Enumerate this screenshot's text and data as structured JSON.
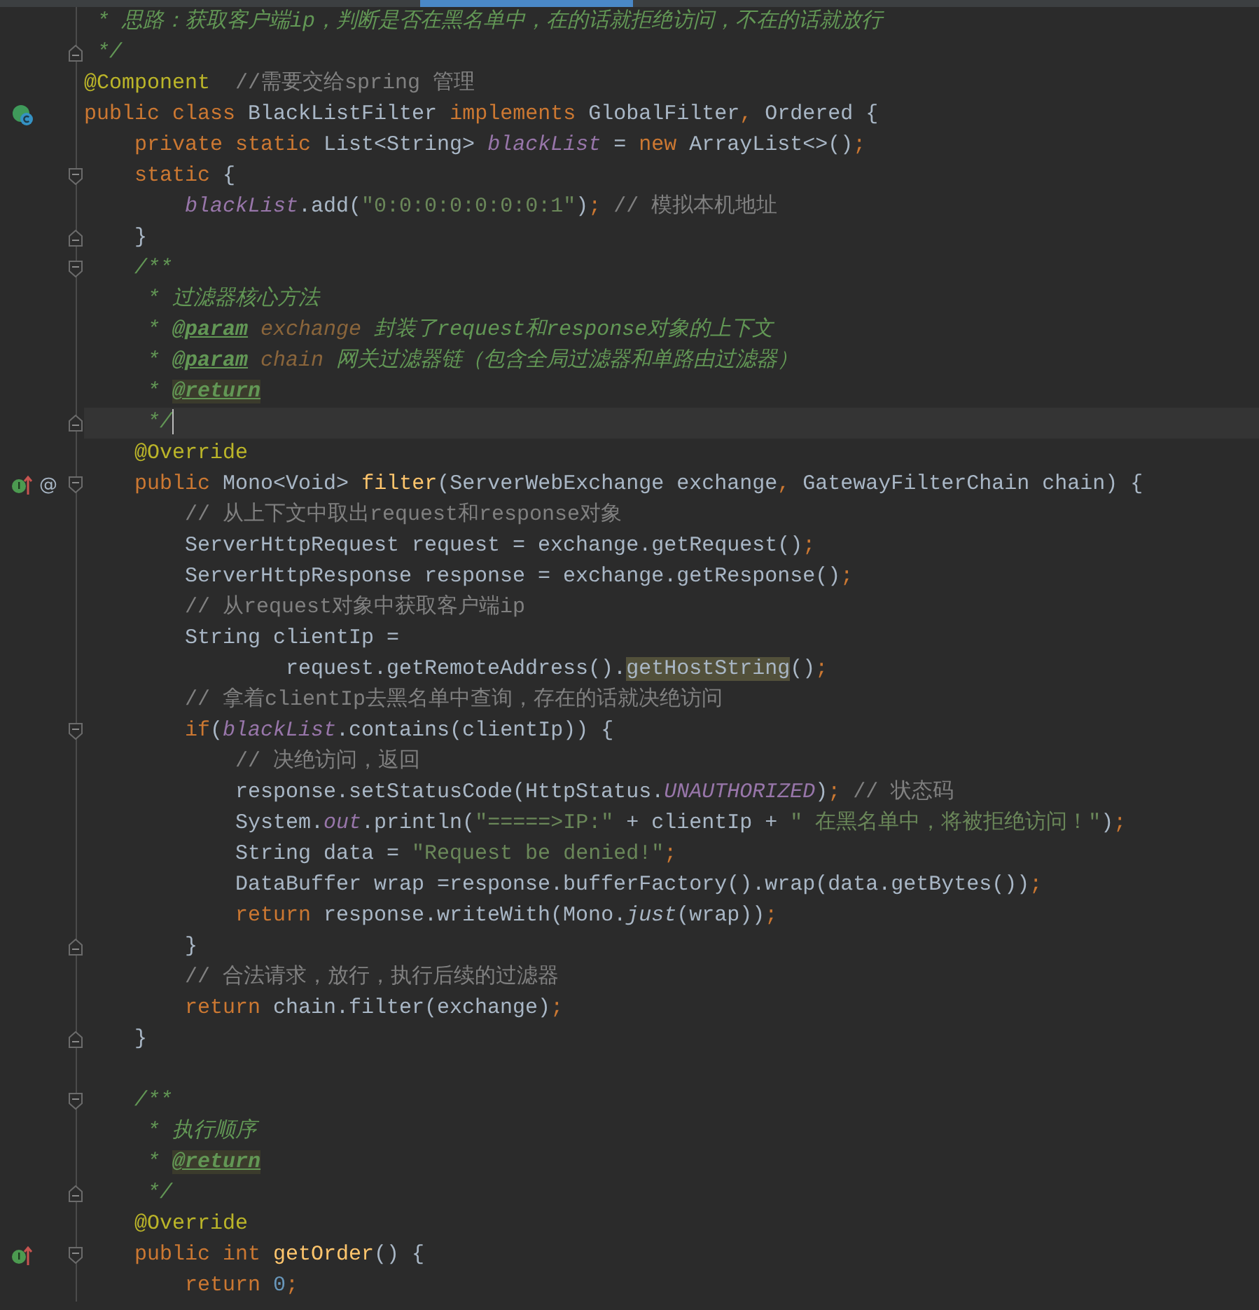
{
  "lines": [
    {
      "current": false,
      "tokens": [
        {
          "kind": "doc",
          "text": " * 思路：获取客户端ip，判断是否在黑名单中，在的话就拒绝访问，不在的话就放行"
        }
      ]
    },
    {
      "current": false,
      "fold": {
        "kind": "end"
      },
      "tokens": [
        {
          "kind": "doc",
          "text": " */"
        }
      ]
    },
    {
      "current": false,
      "tokens": [
        {
          "kind": "ann",
          "text": "@Component"
        },
        {
          "kind": "cmt",
          "text": "  //需要交给spring 管理"
        }
      ]
    },
    {
      "current": false,
      "gutter_icons": [
        {
          "kind": "class"
        }
      ],
      "tokens": [
        {
          "kind": "kw",
          "text": "public class "
        },
        {
          "kind": "plain",
          "text": "BlackListFilter "
        },
        {
          "kind": "kw",
          "text": "implements "
        },
        {
          "kind": "plain",
          "text": "GlobalFilter"
        },
        {
          "kind": "kw",
          "text": ", "
        },
        {
          "kind": "plain",
          "text": "Ordered {"
        }
      ]
    },
    {
      "current": false,
      "tokens": [
        {
          "kind": "kw",
          "text": "    private static "
        },
        {
          "kind": "plain",
          "text": "List<String> "
        },
        {
          "kind": "field",
          "text": "blackList"
        },
        {
          "kind": "plain",
          "text": " = "
        },
        {
          "kind": "kw",
          "text": "new "
        },
        {
          "kind": "plain",
          "text": "ArrayList<>()"
        },
        {
          "kind": "kw",
          "text": ";"
        }
      ]
    },
    {
      "current": false,
      "fold": {
        "kind": "start"
      },
      "tokens": [
        {
          "kind": "kw",
          "text": "    static "
        },
        {
          "kind": "plain",
          "text": "{"
        }
      ]
    },
    {
      "current": false,
      "tokens": [
        {
          "kind": "field",
          "text": "        blackList"
        },
        {
          "kind": "plain",
          "text": ".add("
        },
        {
          "kind": "str",
          "text": "\"0:0:0:0:0:0:0:1\""
        },
        {
          "kind": "plain",
          "text": ")"
        },
        {
          "kind": "kw",
          "text": "; "
        },
        {
          "kind": "cmt",
          "text": "// 模拟本机地址"
        }
      ]
    },
    {
      "current": false,
      "fold": {
        "kind": "end"
      },
      "tokens": [
        {
          "kind": "plain",
          "text": "    }"
        }
      ]
    },
    {
      "current": false,
      "fold": {
        "kind": "start"
      },
      "tokens": [
        {
          "kind": "doc",
          "text": "    /**"
        }
      ]
    },
    {
      "current": false,
      "tokens": [
        {
          "kind": "doc",
          "text": "     * 过滤器核心方法"
        }
      ]
    },
    {
      "current": false,
      "tokens": [
        {
          "kind": "doc",
          "text": "     * "
        },
        {
          "kind": "doctag",
          "text": "@param"
        },
        {
          "kind": "docparam",
          "text": " exchange"
        },
        {
          "kind": "doc",
          "text": " 封装了request和response对象的上下文"
        }
      ]
    },
    {
      "current": false,
      "tokens": [
        {
          "kind": "doc",
          "text": "     * "
        },
        {
          "kind": "doctag",
          "text": "@param"
        },
        {
          "kind": "docparam",
          "text": " chain"
        },
        {
          "kind": "doc",
          "text": " 网关过滤器链（包含全局过滤器和单路由过滤器）"
        }
      ]
    },
    {
      "current": false,
      "tokens": [
        {
          "kind": "doc",
          "text": "     * "
        },
        {
          "kind": "doctaghl",
          "text": "@return"
        }
      ]
    },
    {
      "current": true,
      "fold": {
        "kind": "end"
      },
      "tokens": [
        {
          "kind": "doc",
          "text": "     */"
        }
      ]
    },
    {
      "current": false,
      "tokens": [
        {
          "kind": "ann",
          "text": "    @Override"
        }
      ]
    },
    {
      "current": false,
      "fold": {
        "kind": "start"
      },
      "gutter_icons": [
        {
          "kind": "override"
        }
      ],
      "gutter_text": "@",
      "tokens": [
        {
          "kind": "kw",
          "text": "    public "
        },
        {
          "kind": "plain",
          "text": "Mono<Void> "
        },
        {
          "kind": "decl",
          "text": "filter"
        },
        {
          "kind": "plain",
          "text": "(ServerWebExchange exchange"
        },
        {
          "kind": "kw",
          "text": ", "
        },
        {
          "kind": "plain",
          "text": "GatewayFilterChain chain) {"
        }
      ]
    },
    {
      "current": false,
      "tokens": [
        {
          "kind": "cmt",
          "text": "        // 从上下文中取出request和response对象"
        }
      ]
    },
    {
      "current": false,
      "tokens": [
        {
          "kind": "plain",
          "text": "        ServerHttpRequest request = exchange.getRequest()"
        },
        {
          "kind": "kw",
          "text": ";"
        }
      ]
    },
    {
      "current": false,
      "tokens": [
        {
          "kind": "plain",
          "text": "        ServerHttpResponse response = exchange.getResponse()"
        },
        {
          "kind": "kw",
          "text": ";"
        }
      ]
    },
    {
      "current": false,
      "tokens": [
        {
          "kind": "cmt",
          "text": "        // 从request对象中获取客户端ip"
        }
      ]
    },
    {
      "current": false,
      "tokens": [
        {
          "kind": "plain",
          "text": "        String clientIp ="
        }
      ]
    },
    {
      "current": false,
      "tokens": [
        {
          "kind": "plain",
          "text": "                request.getRemoteAddress()."
        },
        {
          "kind": "usage",
          "text": "getHostString"
        },
        {
          "kind": "plain",
          "text": "()"
        },
        {
          "kind": "kw",
          "text": ";"
        }
      ]
    },
    {
      "current": false,
      "tokens": [
        {
          "kind": "cmt",
          "text": "        // 拿着clientIp去黑名单中查询，存在的话就决绝访问"
        }
      ]
    },
    {
      "current": false,
      "fold": {
        "kind": "start"
      },
      "tokens": [
        {
          "kind": "kw",
          "text": "        if"
        },
        {
          "kind": "plain",
          "text": "("
        },
        {
          "kind": "field",
          "text": "blackList"
        },
        {
          "kind": "plain",
          "text": ".contains(clientIp)) {"
        }
      ]
    },
    {
      "current": false,
      "tokens": [
        {
          "kind": "cmt",
          "text": "            // 决绝访问，返回"
        }
      ]
    },
    {
      "current": false,
      "tokens": [
        {
          "kind": "plain",
          "text": "            response.setStatusCode(HttpStatus."
        },
        {
          "kind": "field",
          "text": "UNAUTHORIZED"
        },
        {
          "kind": "plain",
          "text": ")"
        },
        {
          "kind": "kw",
          "text": "; "
        },
        {
          "kind": "cmt",
          "text": "// 状态码"
        }
      ]
    },
    {
      "current": false,
      "tokens": [
        {
          "kind": "plain",
          "text": "            System."
        },
        {
          "kind": "field",
          "text": "out"
        },
        {
          "kind": "plain",
          "text": ".println("
        },
        {
          "kind": "str",
          "text": "\"=====>IP:\""
        },
        {
          "kind": "plain",
          "text": " + clientIp + "
        },
        {
          "kind": "str",
          "text": "\" 在黑名单中，将被拒绝访问！\""
        },
        {
          "kind": "plain",
          "text": ")"
        },
        {
          "kind": "kw",
          "text": ";"
        }
      ]
    },
    {
      "current": false,
      "tokens": [
        {
          "kind": "plain",
          "text": "            String data = "
        },
        {
          "kind": "str",
          "text": "\"Request be denied!\""
        },
        {
          "kind": "kw",
          "text": ";"
        }
      ]
    },
    {
      "current": false,
      "tokens": [
        {
          "kind": "plain",
          "text": "            DataBuffer wrap =response.bufferFactory().wrap(data.getBytes())"
        },
        {
          "kind": "kw",
          "text": ";"
        }
      ]
    },
    {
      "current": false,
      "tokens": [
        {
          "kind": "kw",
          "text": "            return "
        },
        {
          "kind": "plain",
          "text": "response.writeWith(Mono."
        },
        {
          "kind": "static",
          "text": "just"
        },
        {
          "kind": "plain",
          "text": "(wrap))"
        },
        {
          "kind": "kw",
          "text": ";"
        }
      ]
    },
    {
      "current": false,
      "fold": {
        "kind": "end"
      },
      "tokens": [
        {
          "kind": "plain",
          "text": "        }"
        }
      ]
    },
    {
      "current": false,
      "tokens": [
        {
          "kind": "cmt",
          "text": "        // 合法请求，放行，执行后续的过滤器"
        }
      ]
    },
    {
      "current": false,
      "tokens": [
        {
          "kind": "kw",
          "text": "        return "
        },
        {
          "kind": "plain",
          "text": "chain.filter(exchange)"
        },
        {
          "kind": "kw",
          "text": ";"
        }
      ]
    },
    {
      "current": false,
      "fold": {
        "kind": "end"
      },
      "tokens": [
        {
          "kind": "plain",
          "text": "    }"
        }
      ]
    },
    {
      "current": false
    },
    {
      "current": false,
      "fold": {
        "kind": "start"
      },
      "tokens": [
        {
          "kind": "doc",
          "text": "    /**"
        }
      ]
    },
    {
      "current": false,
      "tokens": [
        {
          "kind": "doc",
          "text": "     * 执行顺序"
        }
      ]
    },
    {
      "current": false,
      "tokens": [
        {
          "kind": "doc",
          "text": "     * "
        },
        {
          "kind": "doctaghl",
          "text": "@return"
        }
      ]
    },
    {
      "current": false,
      "fold": {
        "kind": "end"
      },
      "tokens": [
        {
          "kind": "doc",
          "text": "     */"
        }
      ]
    },
    {
      "current": false,
      "tokens": [
        {
          "kind": "ann",
          "text": "    @Override"
        }
      ]
    },
    {
      "current": false,
      "fold": {
        "kind": "start"
      },
      "gutter_icons": [
        {
          "kind": "override"
        }
      ],
      "tokens": [
        {
          "kind": "kw",
          "text": "    public int "
        },
        {
          "kind": "decl",
          "text": "getOrder"
        },
        {
          "kind": "plain",
          "text": "() {"
        }
      ]
    },
    {
      "current": false,
      "tokens": [
        {
          "kind": "kw",
          "text": "        return "
        },
        {
          "kind": "num",
          "text": "0"
        },
        {
          "kind": "kw",
          "text": ";"
        }
      ]
    }
  ]
}
